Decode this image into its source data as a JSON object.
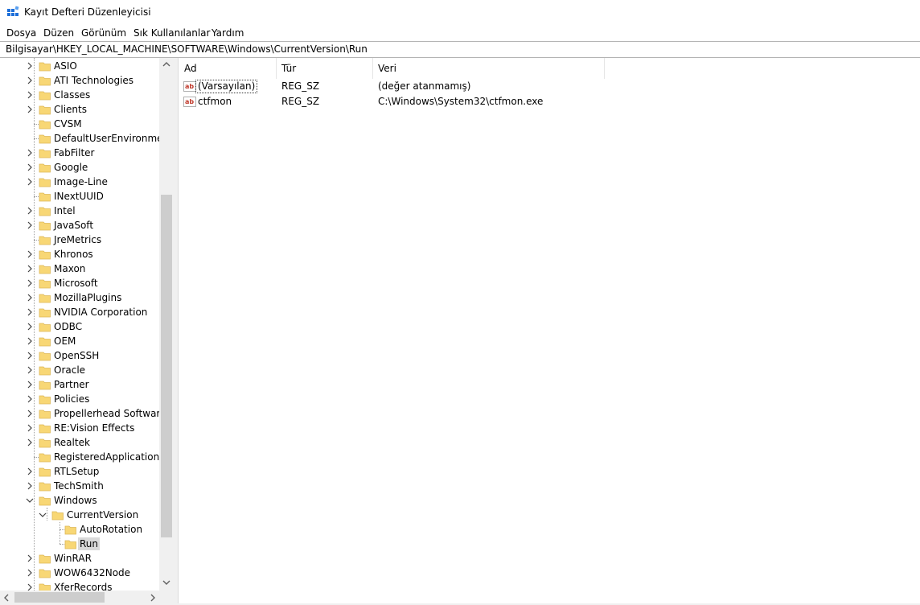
{
  "window": {
    "title": "Kayıt Defteri Düzenleyicisi",
    "icon": "registry-editor-icon"
  },
  "menu": [
    "Dosya",
    "Düzen",
    "Görünüm",
    "Sık Kullanılanlar",
    "Yardım"
  ],
  "address": "Bilgisayar\\HKEY_LOCAL_MACHINE\\SOFTWARE\\Windows\\CurrentVersion\\Run",
  "tree": {
    "nodes": [
      {
        "label": "ASIO",
        "expandable": true
      },
      {
        "label": "ATI Technologies",
        "expandable": true
      },
      {
        "label": "Classes",
        "expandable": true
      },
      {
        "label": "Clients",
        "expandable": true
      },
      {
        "label": "CVSM",
        "expandable": false
      },
      {
        "label": "DefaultUserEnvironment",
        "expandable": false
      },
      {
        "label": "FabFilter",
        "expandable": true
      },
      {
        "label": "Google",
        "expandable": true
      },
      {
        "label": "Image-Line",
        "expandable": true
      },
      {
        "label": "INextUUID",
        "expandable": false
      },
      {
        "label": "Intel",
        "expandable": true
      },
      {
        "label": "JavaSoft",
        "expandable": true
      },
      {
        "label": "JreMetrics",
        "expandable": false
      },
      {
        "label": "Khronos",
        "expandable": true
      },
      {
        "label": "Maxon",
        "expandable": true
      },
      {
        "label": "Microsoft",
        "expandable": true
      },
      {
        "label": "MozillaPlugins",
        "expandable": true
      },
      {
        "label": "NVIDIA Corporation",
        "expandable": true
      },
      {
        "label": "ODBC",
        "expandable": true
      },
      {
        "label": "OEM",
        "expandable": true
      },
      {
        "label": "OpenSSH",
        "expandable": true
      },
      {
        "label": "Oracle",
        "expandable": true
      },
      {
        "label": "Partner",
        "expandable": true
      },
      {
        "label": "Policies",
        "expandable": true
      },
      {
        "label": "Propellerhead Software",
        "expandable": true
      },
      {
        "label": "RE:Vision Effects",
        "expandable": true
      },
      {
        "label": "Realtek",
        "expandable": true
      },
      {
        "label": "RegisteredApplications",
        "expandable": false
      },
      {
        "label": "RTLSetup",
        "expandable": true
      },
      {
        "label": "TechSmith",
        "expandable": true
      },
      {
        "label": "Windows",
        "expandable": true,
        "expanded": true
      },
      {
        "label": "CurrentVersion",
        "expandable": true,
        "expanded": true,
        "level": 1
      },
      {
        "label": "AutoRotation",
        "expandable": false,
        "level": 2
      },
      {
        "label": "Run",
        "expandable": false,
        "level": 2,
        "selected": true
      },
      {
        "label": "WinRAR",
        "expandable": true
      },
      {
        "label": "WOW6432Node",
        "expandable": true
      },
      {
        "label": "XferRecords",
        "expandable": true
      }
    ]
  },
  "list": {
    "columns": [
      "Ad",
      "Tür",
      "Veri"
    ],
    "rows": [
      {
        "name": "(Varsayılan)",
        "type": "REG_SZ",
        "data": "(değer atanmamış)",
        "focused": true
      },
      {
        "name": "ctfmon",
        "type": "REG_SZ",
        "data": "C:\\Windows\\System32\\ctfmon.exe"
      }
    ]
  },
  "colors": {
    "selection": "#d9d9d9",
    "folder": "#f8d775",
    "folder_edge": "#dcb859",
    "string_icon": "#c0392b"
  }
}
